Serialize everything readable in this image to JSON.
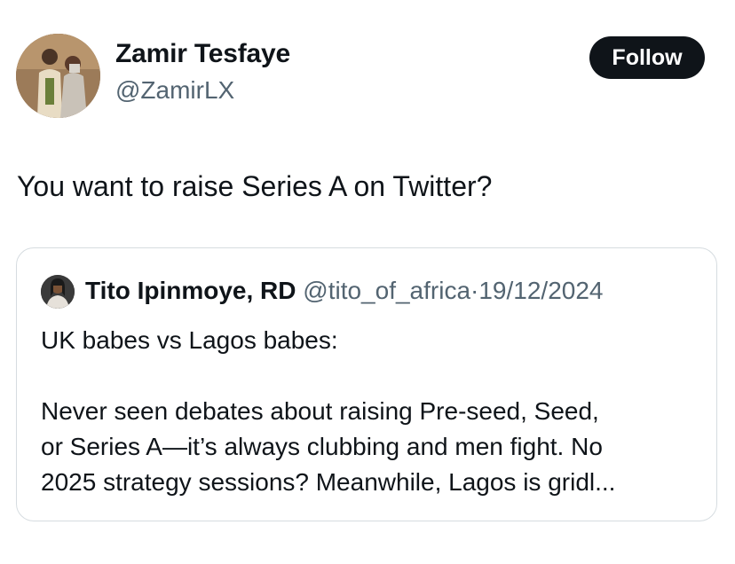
{
  "author": {
    "display_name": "Zamir Tesfaye",
    "handle": "@ZamirLX"
  },
  "follow_label": "Follow",
  "tweet_text": "You want to raise Series A on Twitter?",
  "quoted_tweet": {
    "display_name": "Tito Ipinmoye, RD",
    "handle": "@tito_of_africa",
    "separator": "·",
    "date": "19/12/2024",
    "lines": [
      "UK babes vs Lagos babes:",
      "Never seen debates about raising Pre-seed, Seed,",
      "or Series A—it’s always clubbing and men fight. No",
      "2025 strategy sessions? Meanwhile, Lagos is gridl..."
    ]
  },
  "colors": {
    "text": "#0f1419",
    "secondary": "#536471",
    "border": "#d6dce0",
    "button_bg": "#0f1419",
    "button_text": "#ffffff"
  }
}
